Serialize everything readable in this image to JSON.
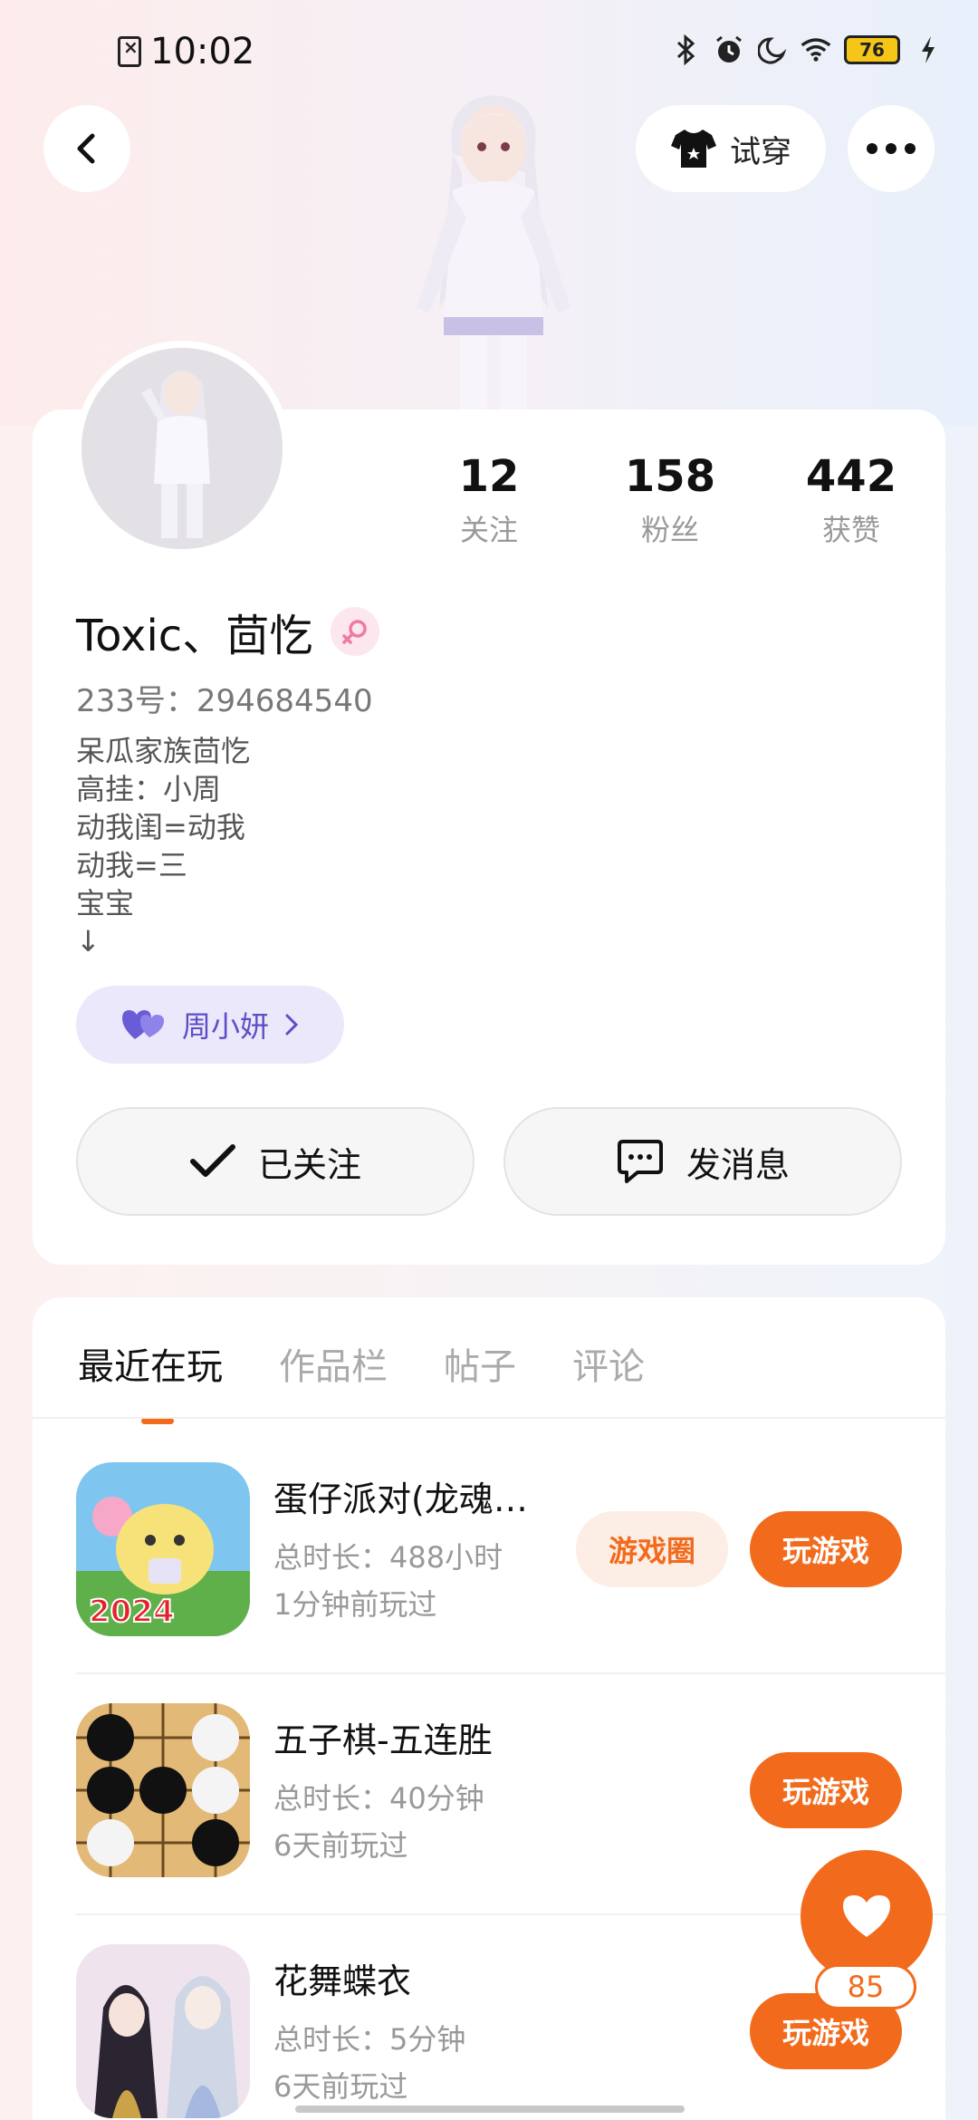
{
  "status_bar": {
    "time": "10:02",
    "battery": "76",
    "icons": [
      "sim-off-icon",
      "bluetooth-icon",
      "alarm-icon",
      "moon-icon",
      "wifi-icon",
      "battery-icon",
      "charging-icon"
    ]
  },
  "header": {
    "tryon_label": "试穿"
  },
  "profile": {
    "stats": [
      {
        "value": "12",
        "label": "关注"
      },
      {
        "value": "158",
        "label": "粉丝"
      },
      {
        "value": "442",
        "label": "获赞"
      }
    ],
    "nickname": "Toxic、茴忔",
    "uid": "233号：294684540",
    "bio": [
      "呆瓜家族茴忔",
      "高挂：小周",
      "动我闺=动我",
      "动我=三",
      "宝宝",
      "↓"
    ],
    "cp_tag": "周小妍",
    "follow_label": "已关注",
    "message_label": "发消息"
  },
  "tabs": [
    "最近在玩",
    "作品栏",
    "帖子",
    "评论"
  ],
  "games": [
    {
      "title": "蛋仔派对(龙魂…",
      "duration": "总时长：488小时",
      "last_played": "1分钟前玩过",
      "circle_label": "游戏圈",
      "play_label": "玩游戏",
      "badge": "2024"
    },
    {
      "title": "五子棋-五连胜",
      "duration": "总时长：40分钟",
      "last_played": "6天前玩过",
      "play_label": "玩游戏"
    },
    {
      "title": "花舞蝶衣",
      "duration": "总时长：5分钟",
      "last_played": "6天前玩过",
      "play_label": "玩游戏"
    }
  ],
  "fab": {
    "count": "85"
  },
  "colors": {
    "accent": "#f26b1d",
    "cp_purple": "#5a4fc4"
  }
}
